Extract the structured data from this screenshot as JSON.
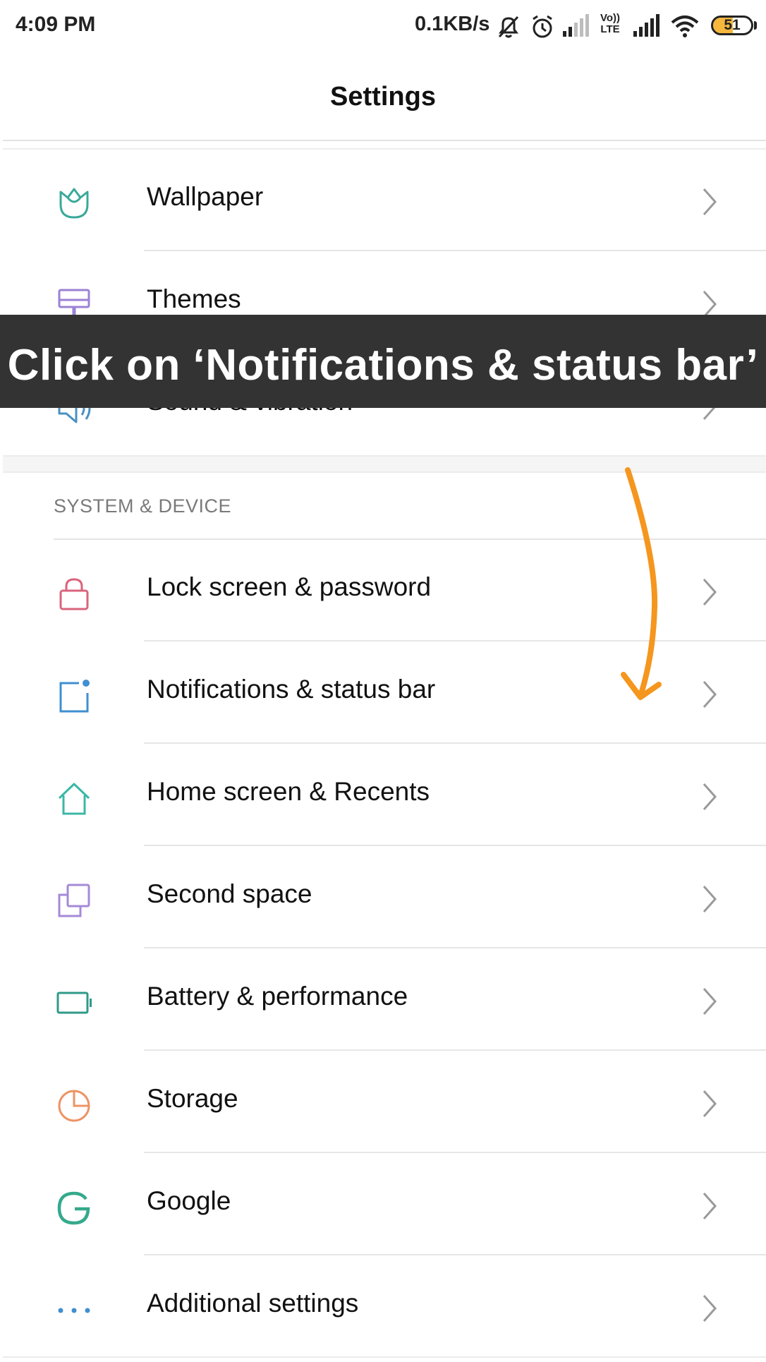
{
  "status_bar": {
    "time": "4:09 PM",
    "net_speed": "0.1KB/s",
    "network_label": "Vo)) LTE",
    "battery_level": "51",
    "battery_fraction": 0.51,
    "icons": [
      "bell-off-icon",
      "alarm-icon",
      "signal-weak-icon",
      "volte-icon",
      "signal-icon",
      "wifi-icon",
      "battery-icon"
    ]
  },
  "header": {
    "title": "Settings"
  },
  "section_personal": {
    "items": [
      {
        "label": "Wallpaper",
        "icon": "tulip-icon",
        "color": "#3aa89a"
      },
      {
        "label": "Themes",
        "icon": "paint-roller-icon",
        "color": "#9b82d6"
      },
      {
        "label": "Sound & vibration",
        "icon": "speaker-icon",
        "color": "#4a90c2"
      }
    ]
  },
  "section_system": {
    "header": "SYSTEM & DEVICE",
    "items": [
      {
        "label": "Lock screen & password",
        "icon": "lock-icon",
        "color": "#d9647c"
      },
      {
        "label": "Notifications & status bar",
        "icon": "notification-icon",
        "color": "#3f8fd1"
      },
      {
        "label": "Home screen & Recents",
        "icon": "home-icon",
        "color": "#3ab8a6"
      },
      {
        "label": "Second space",
        "icon": "second-space-icon",
        "color": "#a58ad8"
      },
      {
        "label": "Battery & performance",
        "icon": "battery-outline-icon",
        "color": "#2f9a88"
      },
      {
        "label": "Storage",
        "icon": "pie-chart-icon",
        "color": "#ec9466"
      },
      {
        "label": "Google",
        "icon": "google-g-icon",
        "color": "#35a98c"
      },
      {
        "label": "Additional settings",
        "icon": "more-dots-icon",
        "color": "#3f8fd1"
      }
    ]
  },
  "overlay": {
    "instruction": "Click on ‘Notifications & status bar’",
    "banner_color": "#333333",
    "arrow_color": "#f5961e"
  }
}
